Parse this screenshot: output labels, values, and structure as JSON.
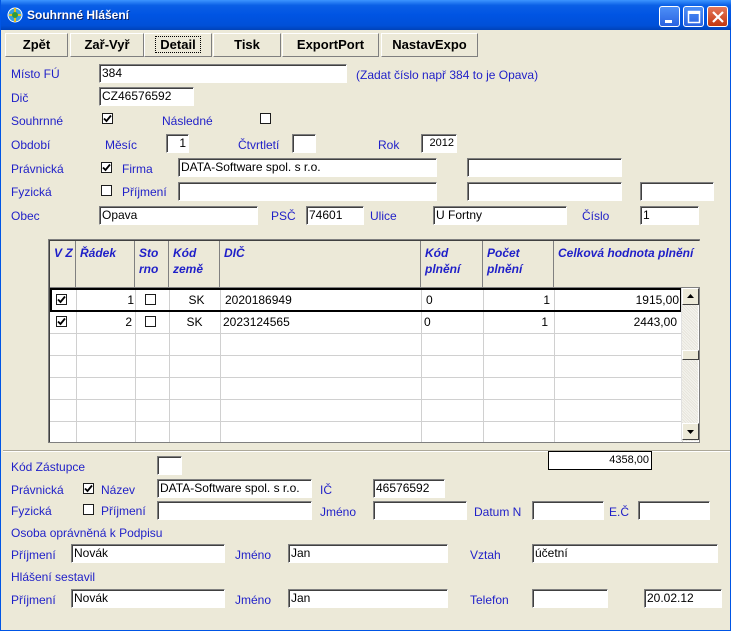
{
  "window": {
    "title": "Souhrnné Hlášení",
    "icon": "app-globe-icon",
    "accent": "#0054e3"
  },
  "toolbar": {
    "buttons": [
      "Zpět",
      "Zař-Vyř",
      "Detail",
      "Tisk",
      "ExportPort",
      "NastavExpo"
    ],
    "active": "Detail"
  },
  "header": {
    "misto_fu_label": "Místo FÚ",
    "misto_fu_value": "384",
    "misto_fu_hint": "(Zadat číslo např 384 to je Opava)",
    "dic_label": "Dič",
    "dic_value": "CZ46576592",
    "souhrnne_label": "Souhrnné",
    "souhrnne_checked": true,
    "nasledne_label": "Následné",
    "nasledne_checked": false,
    "obdobi_label": "Období",
    "mesic_label": "Měsíc",
    "mesic_value": "1",
    "ctvrtleti_label": "Čtvrtletí",
    "ctvrtleti_value": "",
    "rok_label": "Rok",
    "rok_value": "2012",
    "pravnicka_label": "Právnická",
    "pravnicka_checked": true,
    "firma_label": "Firma",
    "firma_value": "DATA-Software spol. s r.o.",
    "firma_extra": "",
    "fyzicka_label": "Fyzická",
    "fyzicka_checked": false,
    "prijmeni_label": "Příjmení",
    "prijmeni_value": "",
    "fyz_extra1": "",
    "fyz_extra2": "",
    "obec_label": "Obec",
    "obec_value": "Opava",
    "psc_label": "PSČ",
    "psc_value": "74601",
    "ulice_label": "Ulice",
    "ulice_value": "U Fortny",
    "cislo_label": "Číslo",
    "cislo_value": "1"
  },
  "grid": {
    "columns": [
      "V Z",
      "Řádek",
      "Sto rno",
      "Kód země",
      "DIČ",
      "Kód plnění",
      "Počet plnění",
      "Celková hodnota plnění"
    ],
    "rows": [
      {
        "vz": true,
        "radek": "1",
        "storno": false,
        "kod_zeme": "SK",
        "dic": "2020186949",
        "kod_plneni": "0",
        "pocet": "1",
        "hodnota": "1915,00"
      },
      {
        "vz": true,
        "radek": "2",
        "storno": false,
        "kod_zeme": "SK",
        "dic": "2023124565",
        "kod_plneni": "0",
        "pocet": "1",
        "hodnota": "2443,00"
      }
    ],
    "total": "4358,00"
  },
  "footer": {
    "kod_zastupce_label": "Kód Zástupce",
    "kod_zastupce_value": "",
    "pravnicka_label": "Právnická",
    "pravnicka_checked": true,
    "nazev_label": "Název",
    "nazev_value": "DATA-Software spol. s r.o.",
    "ic_label": "IČ",
    "ic_value": "46576592",
    "fyzicka_label": "Fyzická",
    "fyzicka_checked": false,
    "prijmeni_label": "Příjmení",
    "prijmeni_value": "",
    "jmeno_label": "Jméno",
    "jmeno_value": "",
    "datum_label": "Datum N",
    "datum_value": "",
    "ec_label": "E.Č",
    "ec_value": "",
    "osoba_label": "Osoba oprávněná k Podpisu",
    "os_prijmeni_label": "Příjmení",
    "os_prijmeni_value": "Novák",
    "os_jmeno_label": "Jméno",
    "os_jmeno_value": "Jan",
    "vztah_label": "Vztah",
    "vztah_value": "účetní",
    "sestavil_label": "Hlášení sestavil",
    "se_prijmeni_label": "Příjmení",
    "se_prijmeni_value": "Novák",
    "se_jmeno_label": "Jméno",
    "se_jmeno_value": "Jan",
    "telefon_label": "Telefon",
    "telefon_value": "",
    "datum2_value": "20.02.12"
  }
}
